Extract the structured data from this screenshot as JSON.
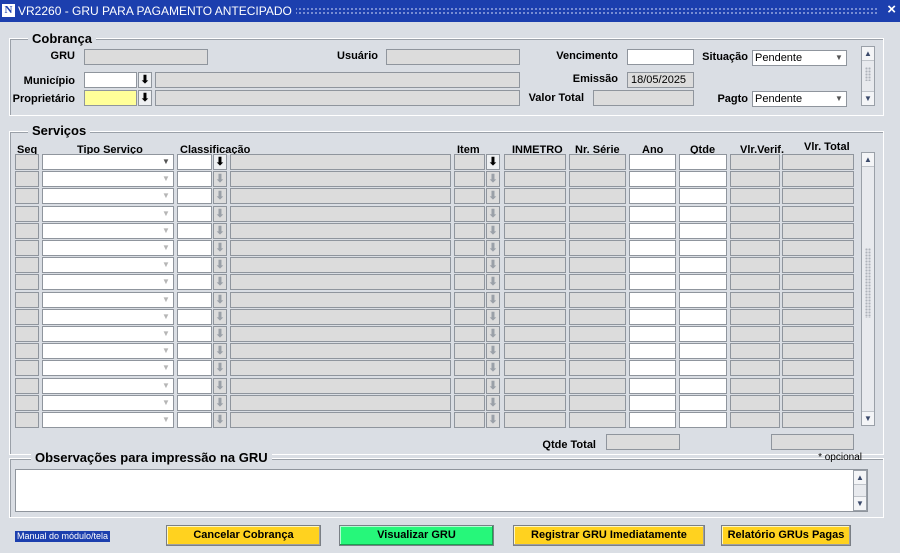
{
  "window": {
    "title": "VR2260 - GRU PARA PAGAMENTO ANTECIPADO",
    "close_label": "×",
    "app_icon": "N"
  },
  "cobranca": {
    "title": "Cobrança",
    "gru_label": "GRU",
    "gru_value": "",
    "usuario_label": "Usuário",
    "usuario_value": "",
    "vencimento_label": "Vencimento",
    "vencimento_value": "",
    "situacao_label": "Situação",
    "situacao_value": "Pendente",
    "municipio_label": "Município",
    "municipio_code": "",
    "municipio_name": "",
    "emissao_label": "Emissão",
    "emissao_value": "18/05/2025",
    "proprietario_label": "Proprietário",
    "proprietario_code": "",
    "proprietario_name": "",
    "valor_total_label": "Valor Total",
    "valor_total_value": "",
    "pagto_label": "Pagto",
    "pagto_value": "Pendente"
  },
  "servicos": {
    "title": "Serviços",
    "columns": {
      "seq": "Seq",
      "tipo_servico": "Tipo Serviço",
      "classificacao": "Classificação",
      "item": "Item",
      "inmetro": "INMETRO",
      "nr_serie": "Nr. Série",
      "ano": "Ano",
      "qtde": "Qtde",
      "vlr_verif": "Vlr.Verif.",
      "vlr_total": "Vlr. Total"
    },
    "row_count": 16,
    "qtde_total_label": "Qtde Total",
    "qtde_total_value": "",
    "vlr_total_sum": ""
  },
  "observacoes": {
    "title": "Observações para impressão na GRU",
    "optional_note": "* opcional",
    "value": ""
  },
  "footer": {
    "help_link": "Manual do módulo/tela",
    "cancel_label": "Cancelar Cobrança",
    "view_label": "Visualizar GRU",
    "register_label": "Registrar GRU Imediatamente",
    "report_label": "Relatório GRUs Pagas"
  },
  "colors": {
    "titlebar": "#1c3fae",
    "background": "#dadee4",
    "yellow_button": "#ffd21f",
    "green_button": "#26f77a",
    "required_field": "#ffff99"
  },
  "icons": {
    "lov": "download-arrow-icon",
    "scroll_up": "scroll-up-icon",
    "scroll_down": "scroll-down-icon",
    "dropdown": "chevron-down-icon"
  }
}
